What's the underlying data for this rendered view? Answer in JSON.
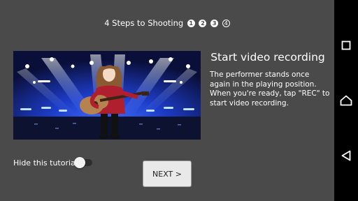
{
  "header": {
    "steps_label": "4 Steps to Shooting",
    "steps": [
      "1",
      "2",
      "3",
      "4"
    ],
    "current_step": 4
  },
  "slide": {
    "title": "Start video recording",
    "description": "The performer stands once again in the playing position. When you're ready, tap \"REC\" to start video recording."
  },
  "footer": {
    "hide_label": "Hide this tutorial.",
    "hide_toggle_on": false,
    "next_label": "NEXT >"
  },
  "navbar": {
    "icons": [
      "recents-icon",
      "home-icon",
      "back-icon"
    ]
  },
  "colors": {
    "background": "#4a4a4a",
    "navbar": "#000000",
    "button": "#e9e9e9",
    "stage_blue": "#1d3cc8",
    "shirt_red": "#b01f2e"
  }
}
